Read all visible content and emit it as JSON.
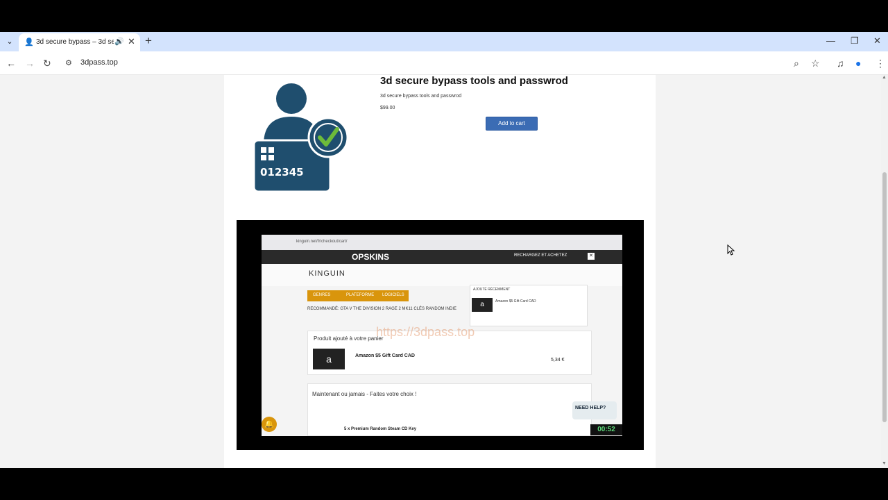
{
  "browser": {
    "tab_title": "3d secure bypass – 3d secu",
    "url": "3dpass.top"
  },
  "product": {
    "title": "3d secure bypass tools and passwrod",
    "description": "3d secure bypass tools and passwrod",
    "price": "$99.00",
    "add_to_cart": "Add to cart",
    "image_digits": "012345"
  },
  "video": {
    "timer": "00:52",
    "screen": {
      "url": "kinguin.net/fr/checkout/cart/",
      "banner_logo": "OPSKINS",
      "banner_right": "RECHARGEZ ET ACHETEZ",
      "site_logo": "KINGUIN",
      "nav": [
        "GENRES",
        "PLATEFORME",
        "LOGICIELS"
      ],
      "recommend": "RECOMMANDÉ: GTA V  THE DIVISION 2  RAGE 2  MK11  CLÉS RANDOM  INDIE",
      "dropdown_title": "AJOUTÉ RÉCEMMENT",
      "dropdown_item": "Amazon $5 Gift Card CAD",
      "watermark": "https://3dpass.top",
      "added_title": "Produit ajouté à votre panier",
      "added_name": "Amazon $5 Gift Card CAD",
      "added_price": "5,34 €",
      "choice_title": "Maintenant ou jamais - Faites votre choix !",
      "choice_item": "5 x Premium Random Steam CD Key",
      "help": "NEED HELP?"
    }
  }
}
